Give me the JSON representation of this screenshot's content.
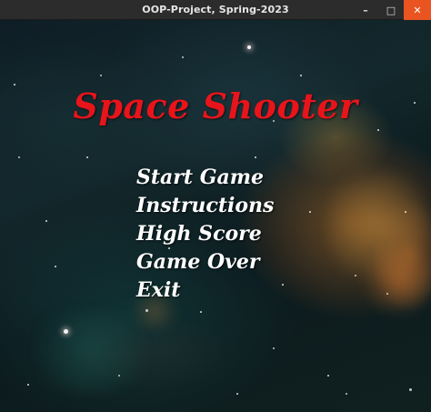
{
  "window": {
    "title": "OOP-Project, Spring-2023",
    "controls": {
      "minimize": "–",
      "maximize": "□",
      "close": "✕"
    }
  },
  "game": {
    "title": "Space Shooter",
    "title_color": "#e8141b",
    "menu": [
      {
        "label": "Start Game"
      },
      {
        "label": "Instructions"
      },
      {
        "label": "High Score"
      },
      {
        "label": "Game Over"
      },
      {
        "label": "Exit"
      }
    ]
  }
}
